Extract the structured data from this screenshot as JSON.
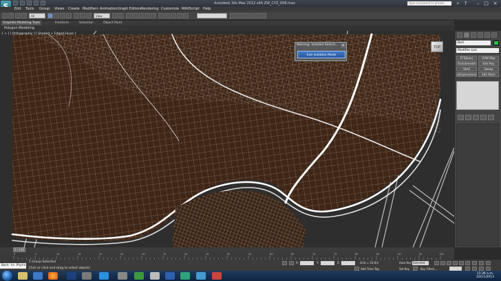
{
  "window": {
    "title": "Autodesk 3ds Max 2012 x64     ZW_CYZ_008.max",
    "search_placeholder": "Type a keyword or phrase",
    "logo_letter": "S"
  },
  "menu": [
    "Edit",
    "Tools",
    "Group",
    "Views",
    "Create",
    "Modifiers",
    "Animation",
    "Graph Editors",
    "Rendering",
    "Customize",
    "MAXScript",
    "Help"
  ],
  "toolbar": {
    "selection_filter": "All",
    "reference_coord": "View",
    "named_selection": ""
  },
  "ribbon": {
    "tabs": [
      "Graphite Modeling Tools",
      "Freeform",
      "Selection",
      "Object Paint"
    ],
    "panel": "Polygon Modeling"
  },
  "viewport": {
    "label": "[ + ] [ Orthographic ] [ Shaded + Edged Faces ]",
    "colors": {
      "mesh_fill": "#3f2617",
      "wire": "#e9e2d2",
      "edge_highlight": "#ffffff"
    }
  },
  "isolate_dialog": {
    "title": "Warning: Isolated Selecti...",
    "close": "x",
    "exit_button": "Exit Isolation Mode"
  },
  "viewcube_label": "TOP",
  "command_panel": {
    "object_name": "Bed",
    "modifier_list": "Modifier List",
    "buttons": [
      "FFD(box)",
      "UVW Map",
      "TurboSmooth",
      "Edit Poly",
      "Shell",
      "Sweep",
      "vDisplacement",
      "Edit Mesh"
    ]
  },
  "timeline": {
    "slider": "0 / 100",
    "ticks": [
      "0",
      "5",
      "10",
      "15",
      "20",
      "25",
      "30",
      "35",
      "40",
      "45",
      "50",
      "55",
      "60",
      "65",
      "70",
      "75",
      "80",
      "85",
      "90",
      "95",
      "100"
    ]
  },
  "status": {
    "maxscript": "Back to Phyto",
    "selection": "1 Group Selected",
    "prompt": "Click or click-and-drag to select objects",
    "x_label": "X:",
    "y_label": "Y:",
    "z_label": "Z:",
    "grid": "Grid = 10.0m",
    "add_time_tag": "Add Time Tag",
    "auto_key": "Auto Key",
    "set_key": "Set Key",
    "key_mode": "Selected",
    "key_filters": "Key Filters..."
  },
  "taskbar": {
    "time": "11:36 a.m.",
    "date": "10/11/2013"
  }
}
